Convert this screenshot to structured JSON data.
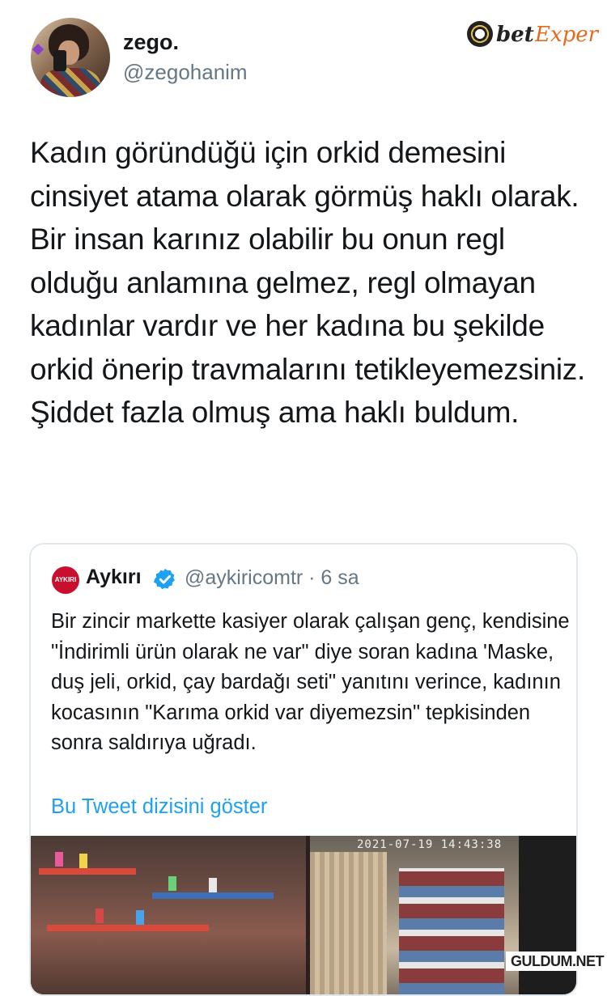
{
  "author": {
    "name": "zego.",
    "handle": "@zegohanim"
  },
  "brand": {
    "part1": "bet",
    "part2": "Exper"
  },
  "tweet": {
    "text": "Kadın göründüğü için orkid demesini cinsiyet atama olarak görmüş haklı olarak. Bir insan karınız olabilir bu onun regl olduğu anlamına gelmez, regl olmayan kadınlar vardır ve her kadına bu şekilde orkid önerip travmalarını tetikleyemezsiniz. Şiddet fazla olmuş ama haklı buldum."
  },
  "quoted": {
    "avatar_label": "AYKIRI",
    "name": "Aykırı",
    "handle_time": "@aykiricomtr · 6 sa",
    "text": "Bir zincir markette kasiyer olarak çalışan genç, kendisine \"İndirimli ürün olarak ne var\" diye soran kadına 'Maske, duş jeli, orkid, çay bardağı seti\" yanıtını verince, kadının kocasının \"Karıma orkid var diyemezsin\" tepkisinden sonra saldırıya uğradı.",
    "show_thread": "Bu Tweet dizisini göster",
    "media_timestamp": "2021-07-19 14:43:38"
  },
  "watermark": "GULDUM.NET",
  "colors": {
    "link": "#1da1f2",
    "muted": "#657786",
    "verified": "#1da1f2",
    "brand_accent": "#e56a1f"
  }
}
